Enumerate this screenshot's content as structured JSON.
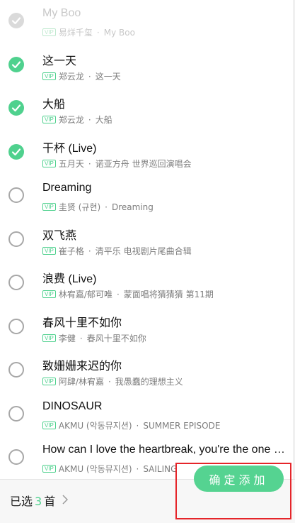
{
  "songs": [
    {
      "title": "My Boo",
      "artist": "易烊千玺",
      "album": "My Boo",
      "vip": "VIP",
      "state": "faded"
    },
    {
      "title": "这一天",
      "artist": "郑云龙",
      "album": "这一天",
      "vip": "VIP",
      "state": "checked"
    },
    {
      "title": "大船",
      "artist": "郑云龙",
      "album": "大船",
      "vip": "VIP",
      "state": "checked"
    },
    {
      "title": "干杯 (Live)",
      "artist": "五月天",
      "album": "诺亚方舟 世界巡回演唱会",
      "vip": "VIP",
      "state": "checked"
    },
    {
      "title": "Dreaming",
      "artist": "圭贤 (규현)",
      "album": "Dreaming",
      "vip": "VIP",
      "state": "unchecked"
    },
    {
      "title": "双飞燕",
      "artist": "崔子格",
      "album": "清平乐 电视剧片尾曲合辑",
      "vip": "VIP",
      "state": "unchecked"
    },
    {
      "title": "浪费 (Live)",
      "artist": "林宥嘉/郁可唯",
      "album": "蒙面唱将猜猜猜 第11期",
      "vip": "VIP",
      "state": "unchecked"
    },
    {
      "title": "春风十里不如你",
      "artist": "李健",
      "album": "春风十里不如你",
      "vip": "VIP",
      "state": "unchecked"
    },
    {
      "title": "致姗姗来迟的你",
      "artist": "阿肆/林宥嘉",
      "album": "我愚蠢的理想主义",
      "vip": "VIP",
      "state": "unchecked"
    },
    {
      "title": "DINOSAUR",
      "artist": "AKMU (악동뮤지션)",
      "album": "SUMMER EPISODE",
      "vip": "VIP",
      "state": "unchecked"
    },
    {
      "title": "How can I love the heartbreak, you're the one I love",
      "artist": "AKMU (악동뮤지션)",
      "album": "SAILING",
      "vip": "VIP",
      "state": "unchecked"
    }
  ],
  "separator": "·",
  "footer": {
    "selected_prefix": "已选",
    "selected_count": "3",
    "selected_suffix": "首",
    "confirm_label": "确定添加"
  },
  "colors": {
    "accent": "#4fd18e",
    "highlight": "#e5252a",
    "checkbox_border": "#a7a7a7"
  },
  "icons": {
    "checked": "check-circle-icon",
    "unchecked": "empty-circle-icon",
    "more": "chevron-right-icon"
  }
}
